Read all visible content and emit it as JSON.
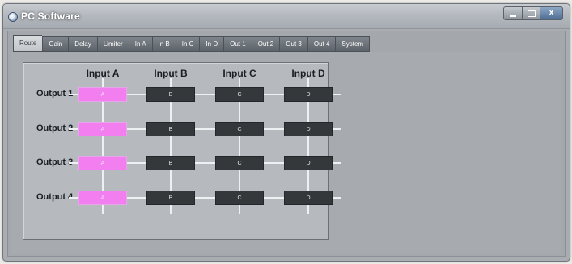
{
  "window": {
    "title": "PC Software",
    "controls": {
      "minimize": "",
      "maximize": "",
      "close": "X"
    }
  },
  "tabs": [
    "Route",
    "Gain",
    "Delay",
    "Limiter",
    "In A",
    "In B",
    "In C",
    "In D",
    "Out 1",
    "Out 2",
    "Out 3",
    "Out 4",
    "System"
  ],
  "active_tab": "Route",
  "matrix": {
    "columns": [
      "Input A",
      "Input B",
      "Input C",
      "Input D"
    ],
    "rows": [
      {
        "label": "Output 1",
        "cells": [
          {
            "text": "A",
            "on": true
          },
          {
            "text": "B",
            "on": false
          },
          {
            "text": "C",
            "on": false
          },
          {
            "text": "D",
            "on": false
          }
        ]
      },
      {
        "label": "Output 2",
        "cells": [
          {
            "text": "A",
            "on": true
          },
          {
            "text": "B",
            "on": false
          },
          {
            "text": "C",
            "on": false
          },
          {
            "text": "D",
            "on": false
          }
        ]
      },
      {
        "label": "Output 3",
        "cells": [
          {
            "text": "A",
            "on": true
          },
          {
            "text": "B",
            "on": false
          },
          {
            "text": "C",
            "on": false
          },
          {
            "text": "D",
            "on": false
          }
        ]
      },
      {
        "label": "Output 4",
        "cells": [
          {
            "text": "A",
            "on": true
          },
          {
            "text": "B",
            "on": false
          },
          {
            "text": "C",
            "on": false
          },
          {
            "text": "D",
            "on": false
          }
        ]
      }
    ]
  },
  "colors": {
    "active_cell": "#f27ef0",
    "inactive_cell": "#35383b",
    "grid_line": "#eef0f2"
  }
}
